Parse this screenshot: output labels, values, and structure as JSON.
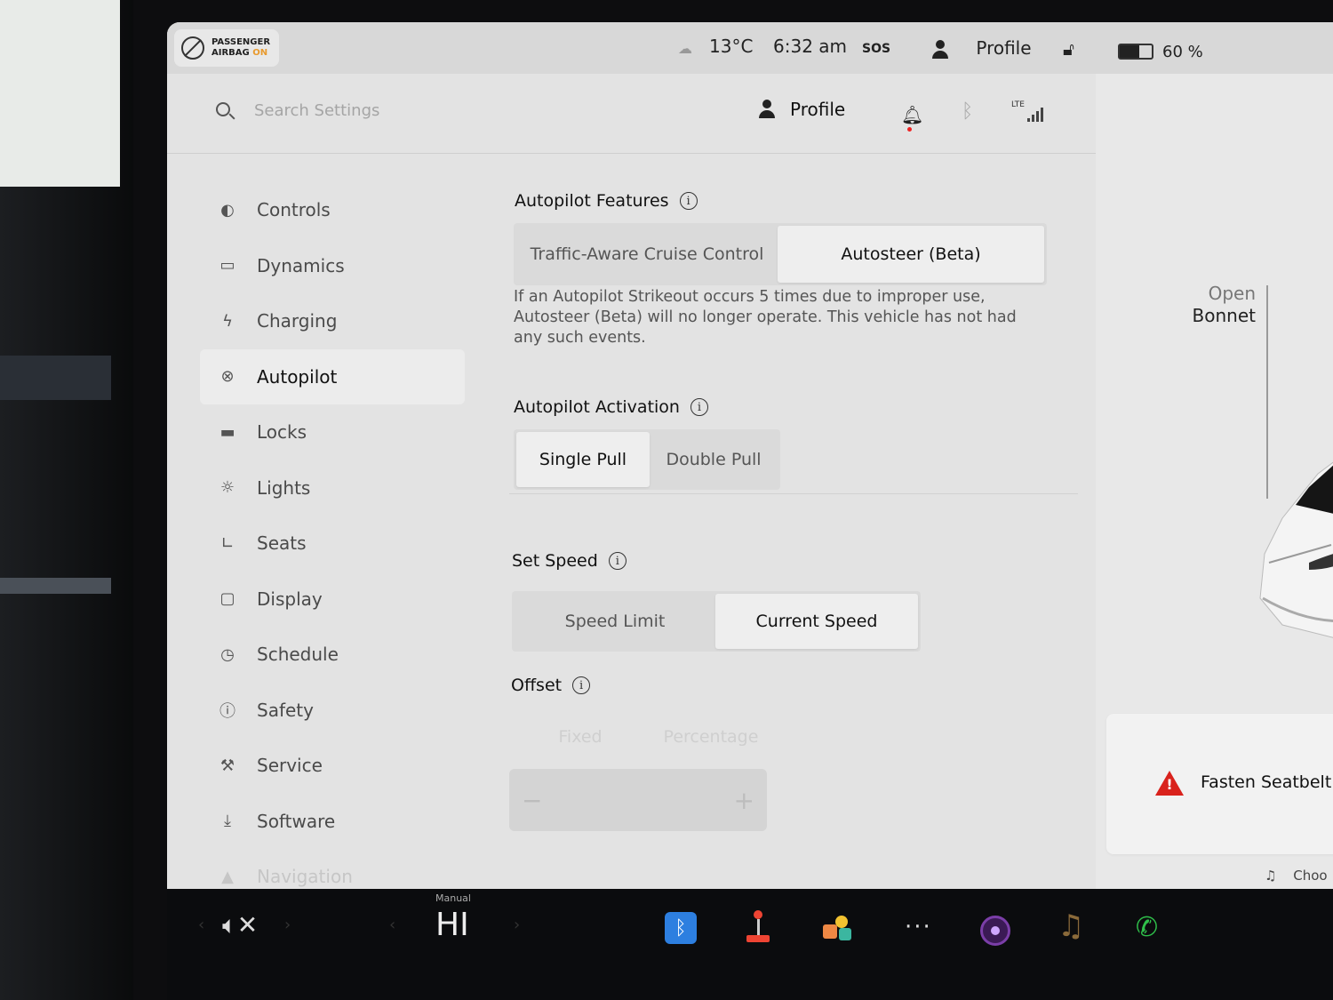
{
  "status_bar": {
    "airbag_line1": "PASSENGER",
    "airbag_line2": "AIRBAG",
    "airbag_state": "ON",
    "temperature": "13°C",
    "time": "6:32 am",
    "sos": "SOS",
    "profile": "Profile",
    "battery_percent": "60 %",
    "battery_level": 0.6
  },
  "header": {
    "search_placeholder": "Search Settings",
    "profile": "Profile",
    "lte": "LTE",
    "icons": [
      "search-icon",
      "person-icon",
      "bell-icon",
      "bluetooth-icon",
      "lte-signal-icon"
    ]
  },
  "sidebar": {
    "items": [
      {
        "label": "Controls",
        "icon": "toggle-icon",
        "glyph": "◐"
      },
      {
        "label": "Dynamics",
        "icon": "car-icon",
        "glyph": "▭"
      },
      {
        "label": "Charging",
        "icon": "lightning-icon",
        "glyph": "ϟ"
      },
      {
        "label": "Autopilot",
        "icon": "steering-wheel-icon",
        "glyph": "⊗"
      },
      {
        "label": "Locks",
        "icon": "lock-icon",
        "glyph": "▬"
      },
      {
        "label": "Lights",
        "icon": "sun-icon",
        "glyph": "☼"
      },
      {
        "label": "Seats",
        "icon": "seat-icon",
        "glyph": "∟"
      },
      {
        "label": "Display",
        "icon": "display-icon",
        "glyph": "▢"
      },
      {
        "label": "Schedule",
        "icon": "alarm-icon",
        "glyph": "◷"
      },
      {
        "label": "Safety",
        "icon": "safety-icon",
        "glyph": "ⓘ"
      },
      {
        "label": "Service",
        "icon": "wrench-icon",
        "glyph": "⚒"
      },
      {
        "label": "Software",
        "icon": "download-icon",
        "glyph": "⤓"
      },
      {
        "label": "Navigation",
        "icon": "navigation-icon",
        "glyph": "▲"
      }
    ],
    "active": "Autopilot"
  },
  "main": {
    "features": {
      "title": "Autopilot Features",
      "options": [
        "Traffic-Aware Cruise Control",
        "Autosteer (Beta)"
      ],
      "selected": "Autosteer (Beta)",
      "description": "If an Autopilot Strikeout occurs 5 times due to improper use, Autosteer (Beta) will no longer operate. This vehicle has not had any such events."
    },
    "activation": {
      "title": "Autopilot Activation",
      "options": [
        "Single Pull",
        "Double Pull"
      ],
      "selected": "Single Pull"
    },
    "set_speed": {
      "title": "Set Speed",
      "options": [
        "Speed Limit",
        "Current Speed"
      ],
      "selected": "Current Speed"
    },
    "offset": {
      "title": "Offset",
      "options": [
        "Fixed",
        "Percentage"
      ],
      "minus": "−",
      "plus": "+"
    }
  },
  "right_panel": {
    "open_bonnet_line1": "Open",
    "open_bonnet_line2": "Bonnet",
    "alert": "Fasten Seatbelt",
    "music_text": "Choo"
  },
  "taskbar": {
    "climate_label": "Manual",
    "climate_value": "HI",
    "volume_icon": "volume-muted-icon",
    "apps": [
      "bluetooth-app-icon",
      "joystick-icon",
      "toybox-icon",
      "more-icon",
      "camera-icon",
      "music-icon",
      "phone-icon"
    ]
  },
  "colors": {
    "accent_blue": "#2d7fe0",
    "alert_red": "#d9221c",
    "phone_green": "#2fbf4a",
    "airbag_on": "#e89a2e"
  }
}
